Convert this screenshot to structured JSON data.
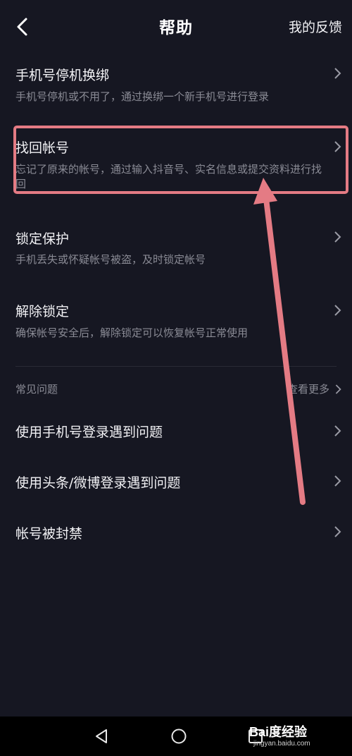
{
  "header": {
    "title": "帮助",
    "feedback_label": "我的反馈"
  },
  "items": [
    {
      "title": "手机号停机换绑",
      "desc": "手机号停机或不用了，通过换绑一个新手机号进行登录"
    },
    {
      "title": "找回帐号",
      "desc": "忘记了原来的帐号，通过输入抖音号、实名信息或提交资料进行找回"
    },
    {
      "title": "锁定保护",
      "desc": "手机丢失或怀疑帐号被盗，及时锁定帐号"
    },
    {
      "title": "解除锁定",
      "desc": "确保帐号安全后，解除锁定可以恢复帐号正常使用"
    }
  ],
  "faq": {
    "label": "常见问题",
    "see_more": "查看更多",
    "items": [
      {
        "title": "使用手机号登录遇到问题"
      },
      {
        "title": "使用头条/微博登录遇到问题"
      },
      {
        "title": "帐号被封禁"
      }
    ]
  },
  "annotation": {
    "color": "#e47b84"
  },
  "watermark": {
    "brand": "Bai度经验",
    "url": "jingyan.baidu.com"
  },
  "icons": {
    "back": "back-arrow-icon",
    "chevron": "chevron-right-icon",
    "nav_back": "triangle-back-icon",
    "nav_home": "circle-home-icon",
    "nav_recent": "square-recent-icon"
  }
}
